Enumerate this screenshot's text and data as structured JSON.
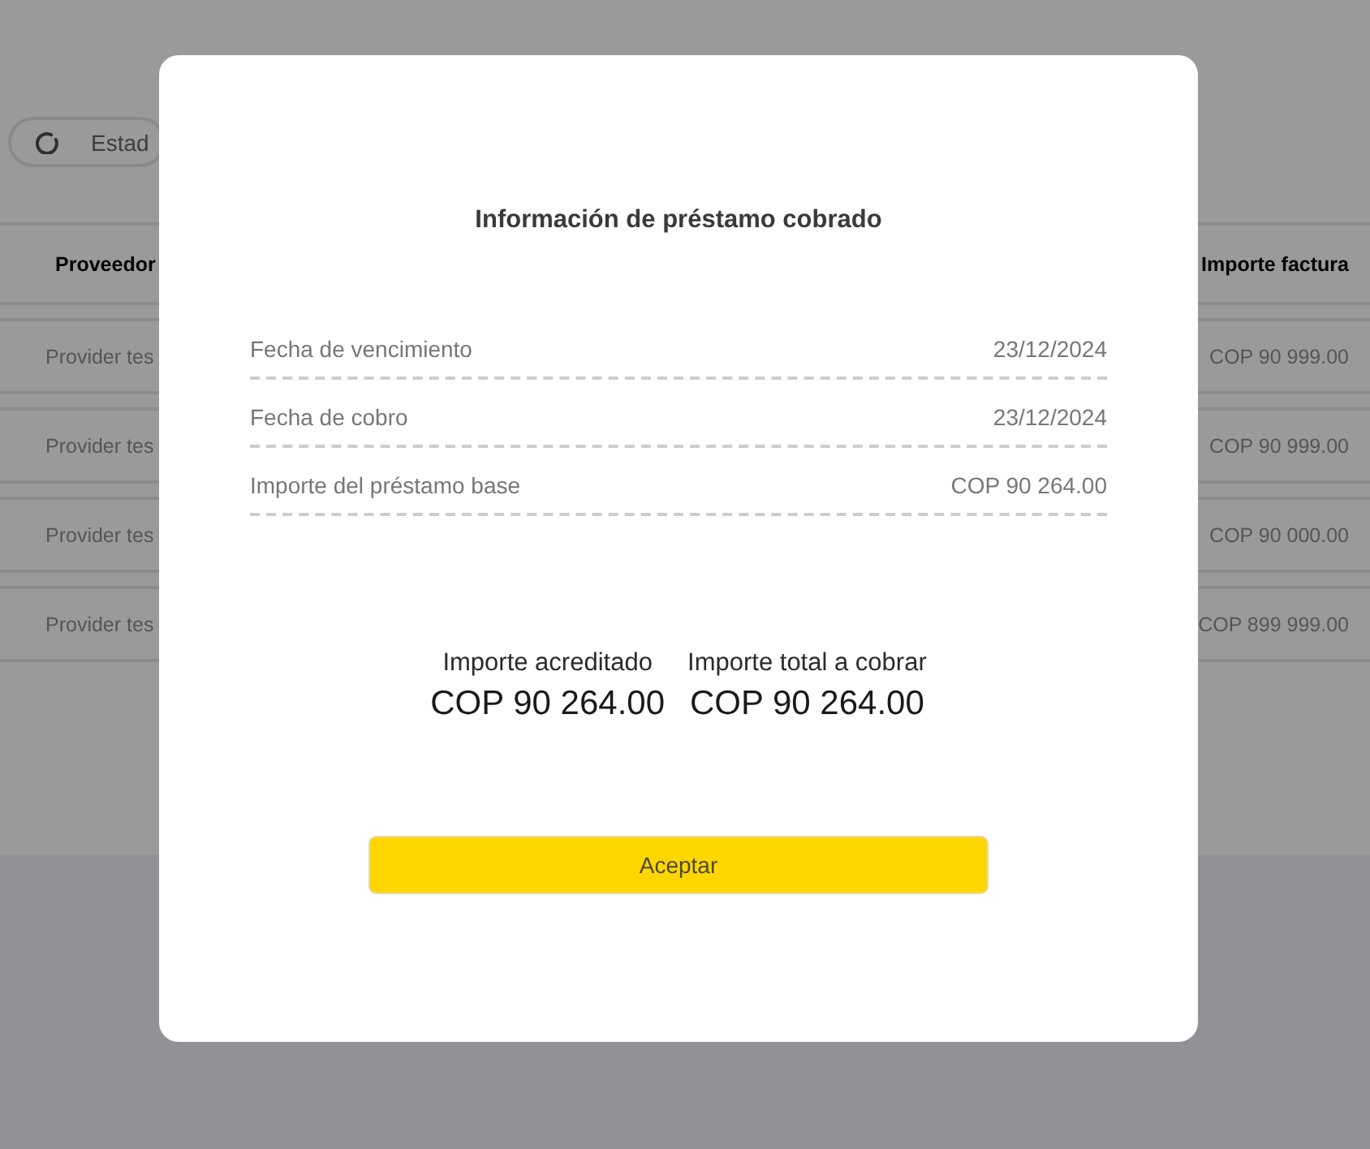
{
  "filter": {
    "label": "Estad"
  },
  "table": {
    "columns": [
      {
        "label": "Proveedor"
      },
      {
        "label": "Importe factura"
      }
    ],
    "rows": [
      {
        "proveedor": "Provider tes",
        "importe_factura": "COP 90 999.00"
      },
      {
        "proveedor": "Provider tes",
        "importe_factura": "COP 90 999.00"
      },
      {
        "proveedor": "Provider tes",
        "importe_factura": "COP 90 000.00"
      },
      {
        "proveedor": "Provider tes",
        "importe_factura": "COP 899 999.00"
      }
    ]
  },
  "dialog": {
    "title": "Información de préstamo cobrado",
    "details": [
      {
        "label": "Fecha de vencimiento",
        "value": "23/12/2024"
      },
      {
        "label": "Fecha de cobro",
        "value": "23/12/2024"
      },
      {
        "label": "Importe del préstamo base",
        "value": "COP 90 264.00"
      }
    ],
    "totals": [
      {
        "label": "Importe acreditado",
        "value": "COP 90 264.00"
      },
      {
        "label": "Importe total a cobrar",
        "value": "COP 90 264.00"
      }
    ],
    "button": {
      "label": "Aceptar"
    }
  }
}
